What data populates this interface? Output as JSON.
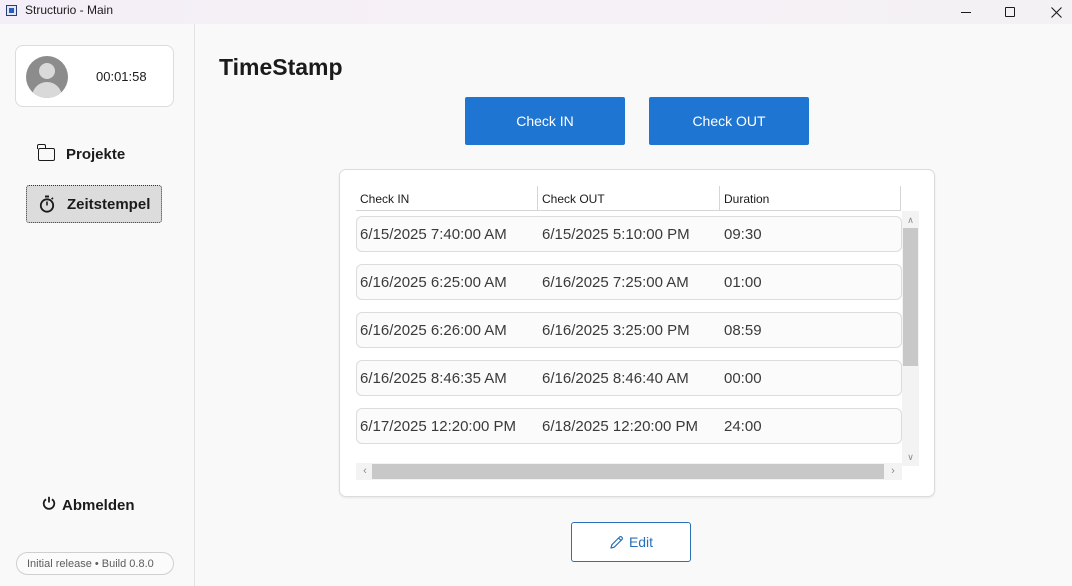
{
  "window": {
    "title": "Structurio - Main",
    "icon": "app-icon",
    "controls": [
      "minimize-icon",
      "maximize-icon",
      "close-icon"
    ]
  },
  "sidebar": {
    "user": {
      "avatar": "avatar-icon",
      "timer": "00:01:58"
    },
    "items": [
      {
        "label": "Projekte",
        "icon": "folder-icon",
        "selected": false
      },
      {
        "label": "Zeitstempel",
        "icon": "stopwatch-icon",
        "selected": true
      }
    ],
    "logout": {
      "label": "Abmelden",
      "icon": "power-icon"
    },
    "version": "Initial release • Build 0.8.0"
  },
  "main": {
    "title": "TimeStamp",
    "check_in_label": "Check IN",
    "check_out_label": "Check OUT",
    "table": {
      "columns": [
        "Check IN",
        "Check OUT",
        "Duration"
      ],
      "rows": [
        {
          "check_in": "6/15/2025 7:40:00 AM",
          "check_out": "6/15/2025 5:10:00 PM",
          "duration": "09:30"
        },
        {
          "check_in": "6/16/2025 6:25:00 AM",
          "check_out": "6/16/2025 7:25:00 AM",
          "duration": "01:00"
        },
        {
          "check_in": "6/16/2025 6:26:00 AM",
          "check_out": "6/16/2025 3:25:00 PM",
          "duration": "08:59"
        },
        {
          "check_in": "6/16/2025 8:46:35 AM",
          "check_out": "6/16/2025 8:46:40 AM",
          "duration": "00:00"
        },
        {
          "check_in": "6/17/2025 12:20:00 PM",
          "check_out": "6/18/2025 12:20:00 PM",
          "duration": "24:00"
        }
      ]
    },
    "edit_label": "Edit",
    "colors": {
      "accent": "#1f76d2",
      "edit_border": "#2a6fb8"
    }
  }
}
